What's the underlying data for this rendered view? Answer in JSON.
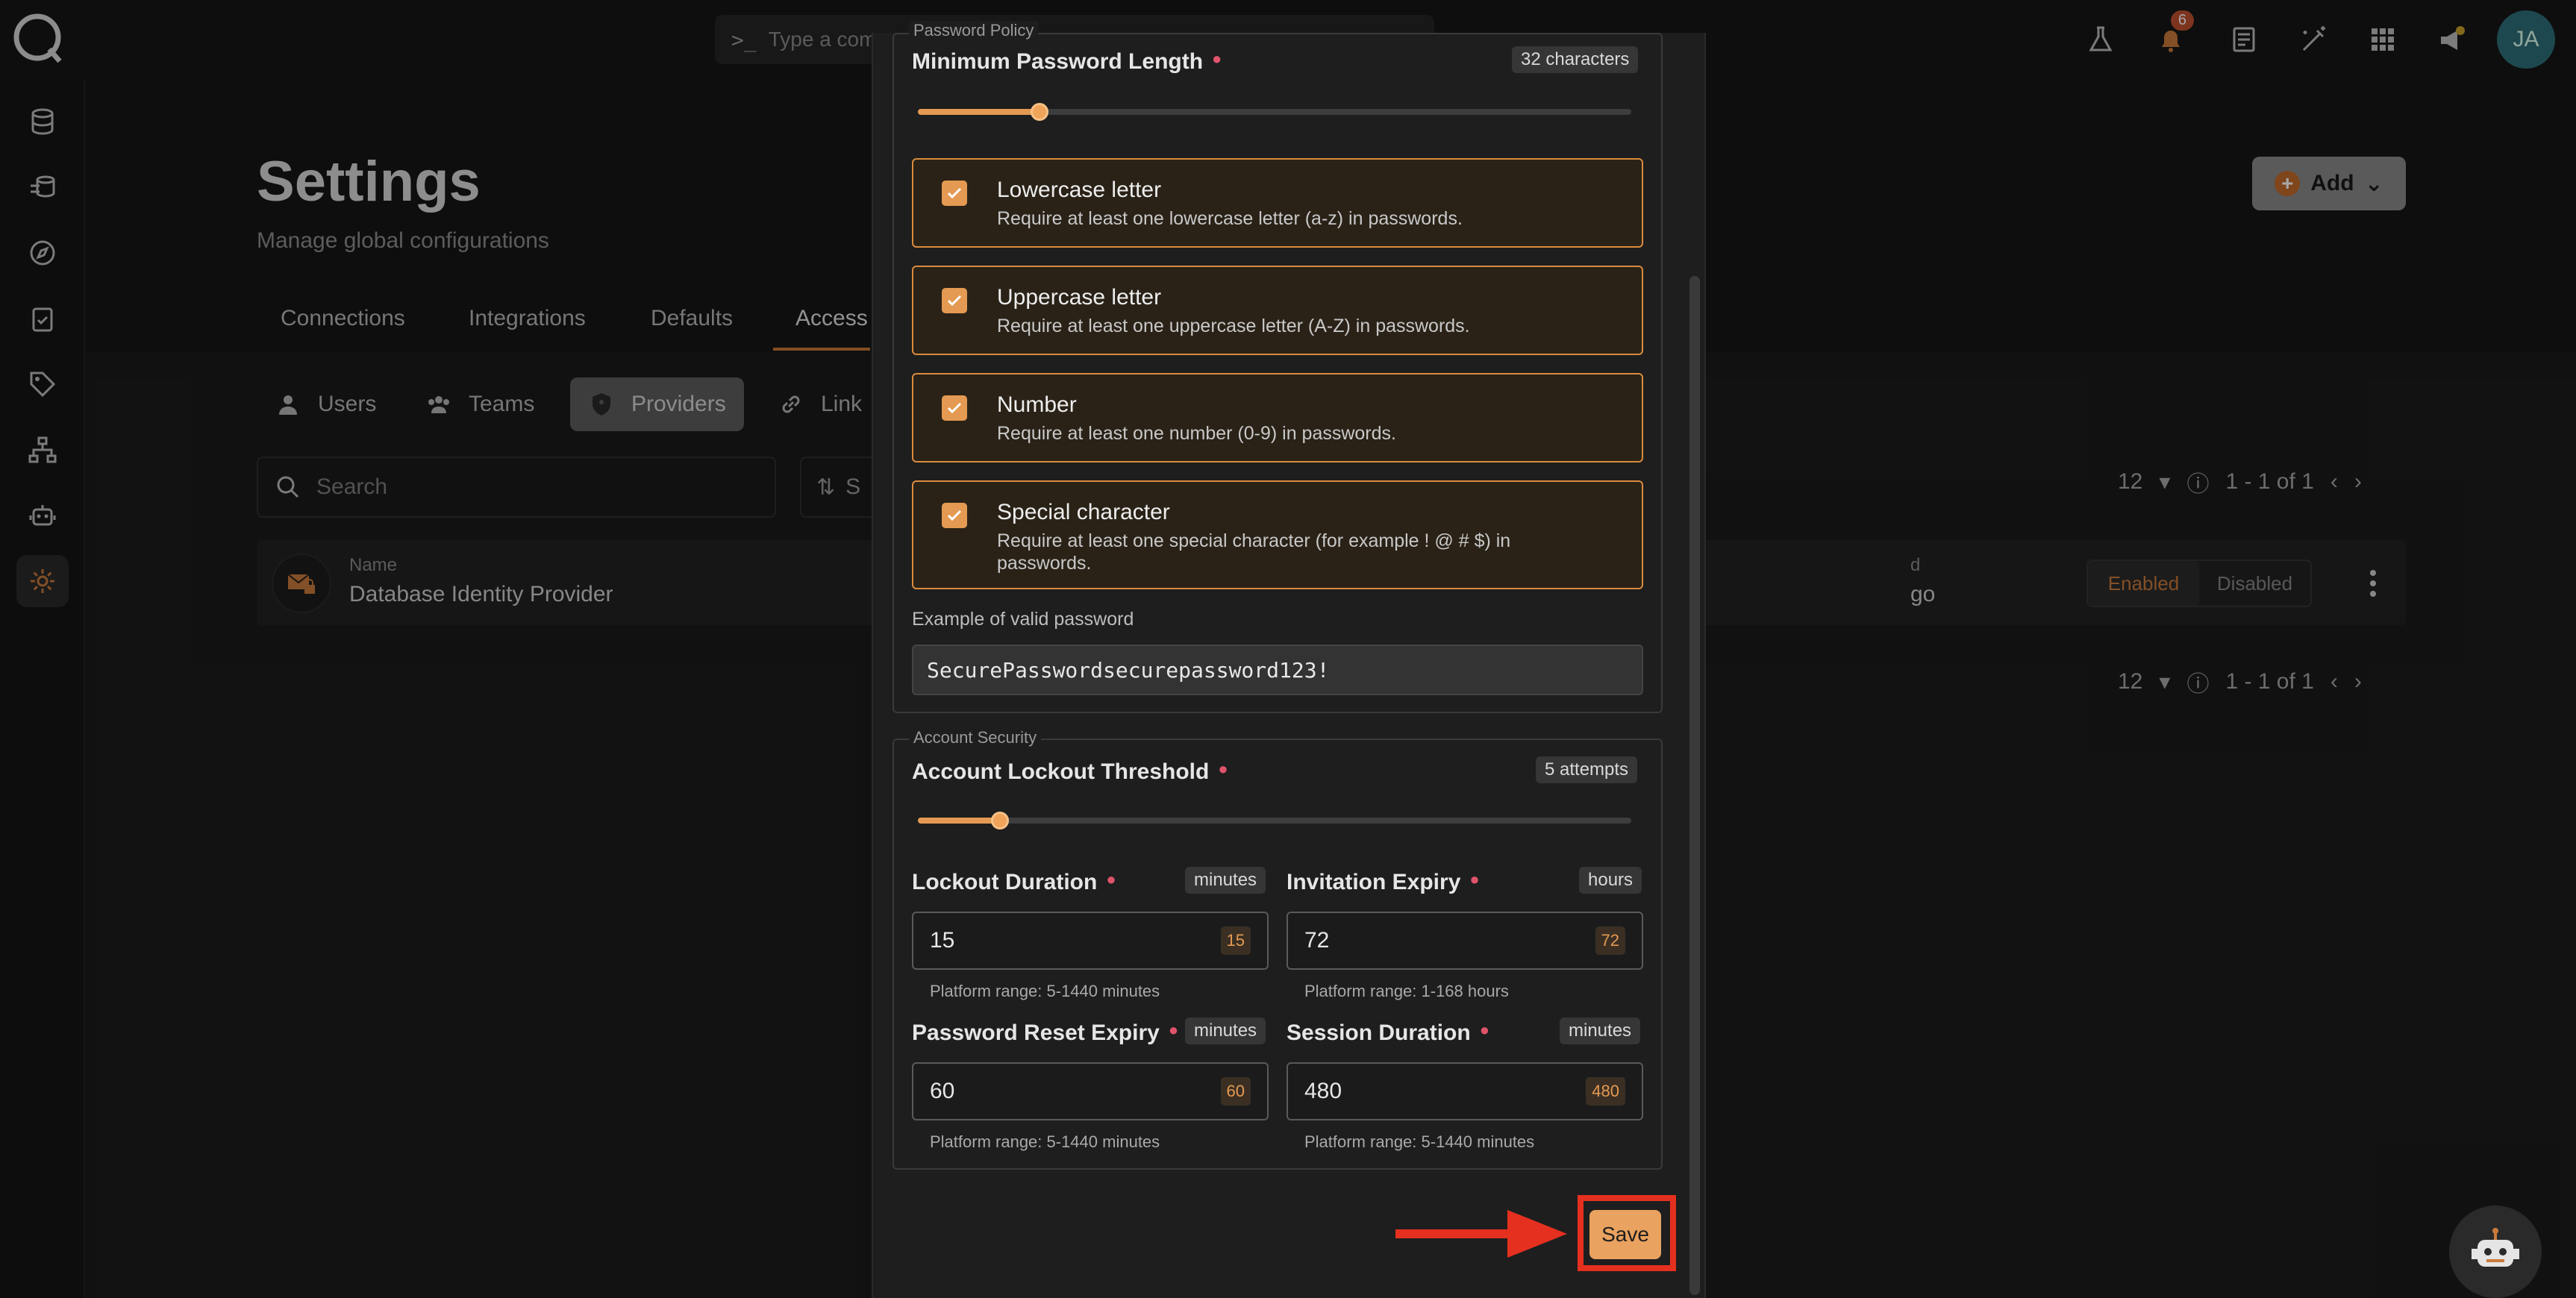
{
  "command_bar": {
    "placeholder": "Type a comm"
  },
  "notifications_count": "6",
  "avatar_initials": "JA",
  "page": {
    "title": "Settings",
    "subtitle": "Manage global configurations"
  },
  "tabs": [
    "Connections",
    "Integrations",
    "Defaults",
    "Access"
  ],
  "subtabs": [
    "Users",
    "Teams",
    "Providers",
    "Link"
  ],
  "add_button": "Add",
  "search_placeholder": "Search",
  "sort_fragment": "S",
  "pager": {
    "per_page": "12",
    "range": "1 - 1 of 1"
  },
  "row": {
    "name_label": "Name",
    "name_value": "Database Identity Provider",
    "right_label_fragment": "d",
    "right_value_fragment": "go",
    "enabled": "Enabled",
    "disabled": "Disabled"
  },
  "modal": {
    "password_policy_legend": "Password Policy",
    "min_length_label": "Minimum Password Length",
    "min_length_chip": "32 characters",
    "min_length_value": 32,
    "min_length_fraction": 0.17,
    "rules": [
      {
        "title": "Lowercase letter",
        "desc": "Require at least one lowercase letter (a-z) in passwords.",
        "checked": true
      },
      {
        "title": "Uppercase letter",
        "desc": "Require at least one uppercase letter (A-Z) in passwords.",
        "checked": true
      },
      {
        "title": "Number",
        "desc": "Require at least one number (0-9) in passwords.",
        "checked": true
      },
      {
        "title": "Special character",
        "desc": "Require at least one special character (for example ! @ # $) in passwords.",
        "checked": true
      }
    ],
    "example_label": "Example of valid password",
    "example_value": "SecurePasswordsecurepassword123!",
    "account_security_legend": "Account Security",
    "lockout_threshold_label": "Account Lockout Threshold",
    "lockout_threshold_chip": "5 attempts",
    "lockout_threshold_value": 5,
    "lockout_threshold_fraction": 0.115,
    "fields": {
      "lockout_duration": {
        "label": "Lockout Duration",
        "unit": "minutes",
        "value": "15",
        "mini": "15",
        "hint": "Platform range: 5-1440 minutes"
      },
      "invitation_expiry": {
        "label": "Invitation Expiry",
        "unit": "hours",
        "value": "72",
        "mini": "72",
        "hint": "Platform range: 1-168 hours"
      },
      "password_reset_expiry": {
        "label": "Password Reset Expiry",
        "unit": "minutes",
        "value": "60",
        "mini": "60",
        "hint": "Platform range: 5-1440 minutes"
      },
      "session_duration": {
        "label": "Session Duration",
        "unit": "minutes",
        "value": "480",
        "mini": "480",
        "hint": "Platform range: 5-1440 minutes"
      }
    },
    "save_label": "Save"
  },
  "colors": {
    "accent": "#e49a52",
    "required": "#e0546b",
    "highlight": "#e5301f"
  }
}
